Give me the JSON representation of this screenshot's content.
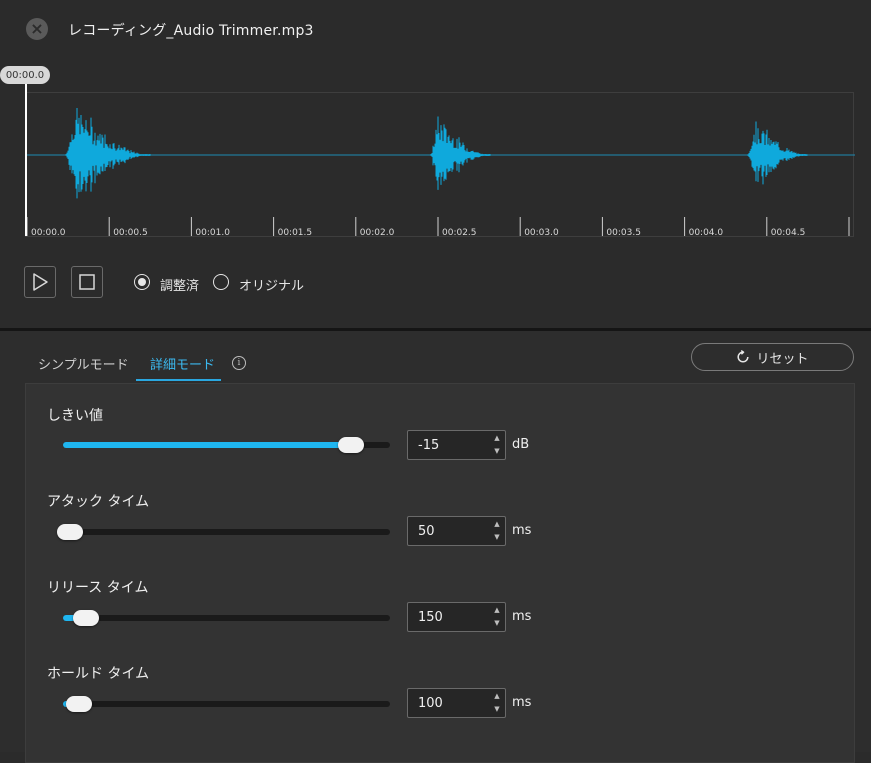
{
  "window": {
    "title": "レコーディング_Audio Trimmer.mp3",
    "close_glyph": "×"
  },
  "waveform": {
    "playhead_time": "00:00.0",
    "ticks": [
      "00:00.0",
      "00:00.5",
      "00:01.0",
      "00:01.5",
      "00:02.0",
      "00:02.5",
      "00:03.0",
      "00:03.5",
      "00:04.0",
      "00:04.5"
    ],
    "wave_color": "#0fa9dc",
    "axis_color": "#1d8bb3"
  },
  "playback": {
    "play_icon": "play-icon",
    "stop_icon": "stop-icon",
    "options": [
      {
        "label": "調整済",
        "selected": true
      },
      {
        "label": "オリジナル",
        "selected": false
      }
    ]
  },
  "tabs": {
    "simple": "シンプルモード",
    "advanced": "詳細モード",
    "active": "advanced",
    "info_glyph": "i"
  },
  "reset": {
    "label": "リセット",
    "icon": "refresh-icon"
  },
  "params": [
    {
      "label": "しきい値",
      "value": "-15",
      "unit": "dB",
      "fraction": 0.88
    },
    {
      "label": "アタック タイム",
      "value": "50",
      "unit": "ms",
      "fraction": 0.02
    },
    {
      "label": "リリース タイム",
      "value": "150",
      "unit": "ms",
      "fraction": 0.07
    },
    {
      "label": "ホールド タイム",
      "value": "100",
      "unit": "ms",
      "fraction": 0.05
    }
  ],
  "spinner": {
    "up": "▲",
    "down": "▼"
  }
}
